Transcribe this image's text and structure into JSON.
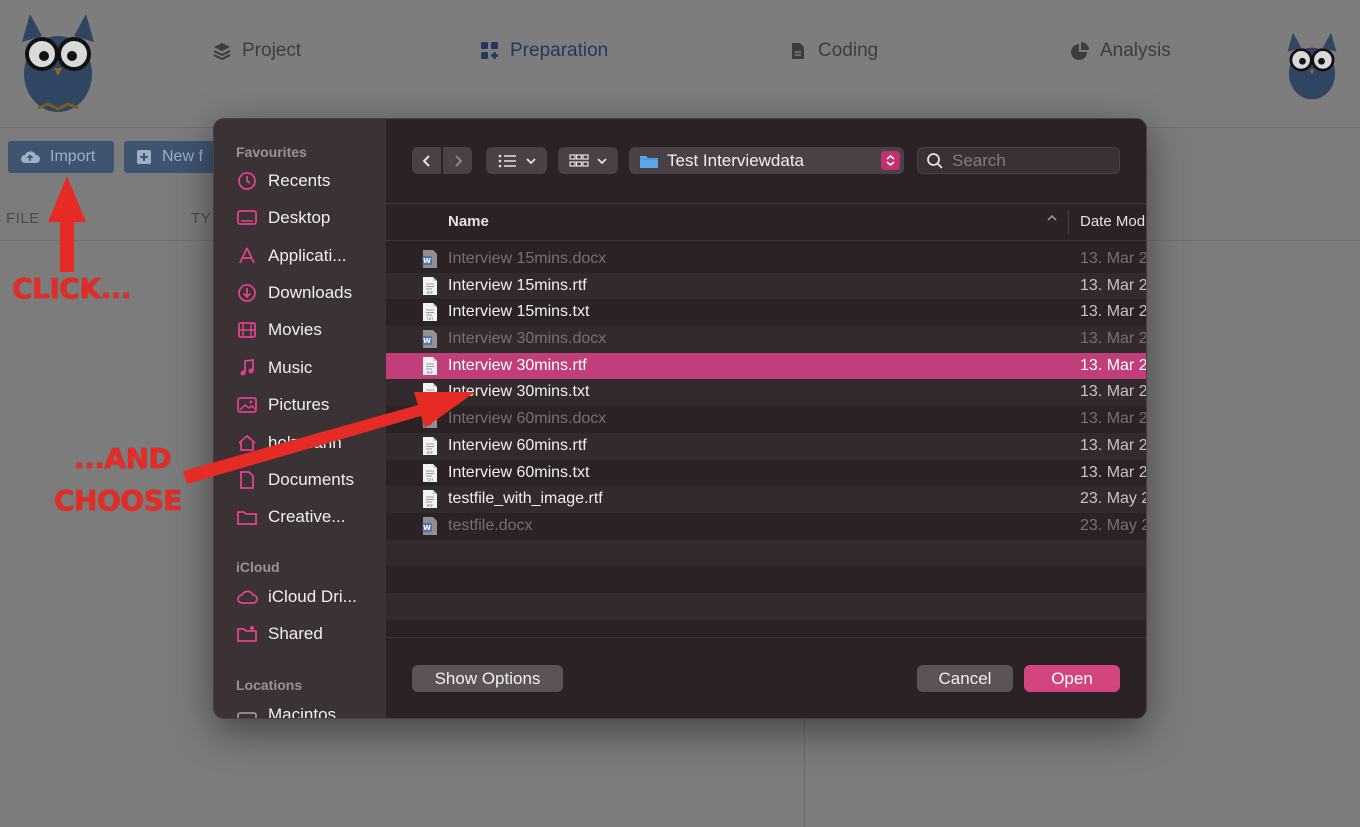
{
  "app": {
    "nav": [
      {
        "label": "Project",
        "icon": "layers-icon"
      },
      {
        "label": "Preparation",
        "icon": "apps-add-icon"
      },
      {
        "label": "Coding",
        "icon": "document-icon"
      },
      {
        "label": "Analysis",
        "icon": "pie-chart-icon"
      }
    ],
    "active_nav": "Preparation",
    "import_label": "Import",
    "new_label": "New f",
    "col_file": "FILE",
    "col_type": "TY"
  },
  "annotations": {
    "click": "CLICK...",
    "and": "...AND",
    "choose": "CHOOSE",
    "color": "#e52b24"
  },
  "dialog": {
    "sidebar": {
      "sections": [
        {
          "title": "Favourites",
          "items": [
            {
              "label": "Recents",
              "icon": "clock-icon"
            },
            {
              "label": "Desktop",
              "icon": "desktop-icon"
            },
            {
              "label": "Applicati...",
              "icon": "applications-icon"
            },
            {
              "label": "Downloads",
              "icon": "download-icon"
            },
            {
              "label": "Movies",
              "icon": "film-icon"
            },
            {
              "label": "Music",
              "icon": "music-note-icon"
            },
            {
              "label": "Pictures",
              "icon": "photo-icon"
            },
            {
              "label": "holzmann",
              "icon": "home-icon"
            },
            {
              "label": "Documents",
              "icon": "doc-icon"
            },
            {
              "label": "Creative...",
              "icon": "folder-icon"
            }
          ]
        },
        {
          "title": "iCloud",
          "items": [
            {
              "label": "iCloud Dri...",
              "icon": "cloud-icon"
            },
            {
              "label": "Shared",
              "icon": "shared-folder-icon"
            }
          ]
        },
        {
          "title": "Locations",
          "items": [
            {
              "label": "Macintos...",
              "icon": "disk-icon"
            }
          ]
        }
      ]
    },
    "toolbar": {
      "folder": "Test Interviewdata",
      "search_placeholder": "Search"
    },
    "columns": {
      "name": "Name",
      "date": "Date Mod"
    },
    "files": [
      {
        "name": "Interview 15mins.docx",
        "date": "13. Mar 2",
        "type": "docx",
        "dim": true
      },
      {
        "name": "Interview 15mins.rtf",
        "date": "13. Mar 2",
        "type": "rtf",
        "dim": false
      },
      {
        "name": "Interview 15mins.txt",
        "date": "13. Mar 2",
        "type": "txt",
        "dim": false
      },
      {
        "name": "Interview 30mins.docx",
        "date": "13. Mar 2",
        "type": "docx",
        "dim": true
      },
      {
        "name": "Interview 30mins.rtf",
        "date": "13. Mar 2",
        "type": "rtf",
        "dim": false,
        "selected": true
      },
      {
        "name": "Interview 30mins.txt",
        "date": "13. Mar 2",
        "type": "txt",
        "dim": false
      },
      {
        "name": "Interview 60mins.docx",
        "date": "13. Mar 2",
        "type": "docx",
        "dim": true
      },
      {
        "name": "Interview 60mins.rtf",
        "date": "13. Mar 2",
        "type": "rtf",
        "dim": false
      },
      {
        "name": "Interview 60mins.txt",
        "date": "13. Mar 2",
        "type": "txt",
        "dim": false
      },
      {
        "name": "testfile_with_image.rtf",
        "date": "23. May 2",
        "type": "rtf",
        "dim": false
      },
      {
        "name": "testfile.docx",
        "date": "23. May 2",
        "type": "docx",
        "dim": true
      }
    ],
    "buttons": {
      "options": "Show Options",
      "cancel": "Cancel",
      "open": "Open"
    },
    "accent": "#d2457f"
  }
}
